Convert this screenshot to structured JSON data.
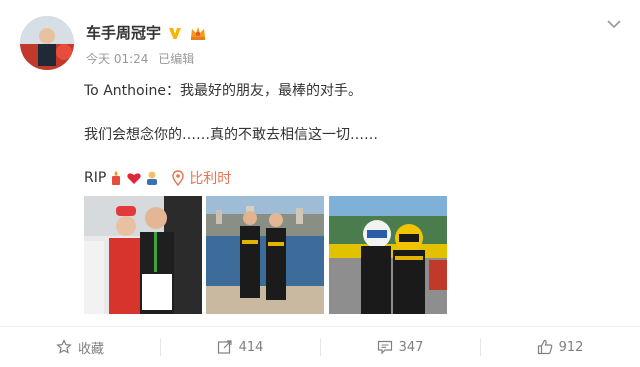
{
  "user": {
    "name": "车手周冠宇",
    "verified_icon": "verified-v-icon",
    "crown_icon": "crown-icon"
  },
  "meta": {
    "time": "今天 01:24",
    "edited": "已编辑"
  },
  "post": {
    "line1": "To Anthoine：我最好的朋友，最棒的对手。",
    "line2": "我们会想念你的……真的不敢去相信这一切……",
    "rip": "RIP",
    "emoji": [
      "candle-icon",
      "heart-icon",
      "pray-icon"
    ],
    "location": "比利时"
  },
  "photos": [
    {
      "name": "photo-podium-handshake"
    },
    {
      "name": "photo-monaco-harbor"
    },
    {
      "name": "photo-helmets-track"
    }
  ],
  "footer": {
    "favorite_label": "收藏",
    "repost_count": "414",
    "comment_count": "347",
    "like_count": "912"
  },
  "colors": {
    "accent": "#eb7350",
    "verified": "#f7b500",
    "muted": "#999999"
  }
}
